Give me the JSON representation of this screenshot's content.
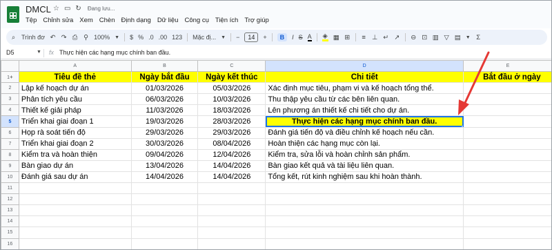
{
  "app": {
    "doc_title": "DMCL",
    "save_status": "Đang lưu...",
    "menu": [
      "Tệp",
      "Chỉnh sửa",
      "Xem",
      "Chèn",
      "Định dạng",
      "Dữ liệu",
      "Công cụ",
      "Tiện ích",
      "Trợ giúp"
    ]
  },
  "toolbar": {
    "search_label": "Trình đơ",
    "zoom": "100%",
    "currency": "$",
    "percent": "%",
    "dec_decrease": ".0",
    "dec_increase": ".00",
    "number_format": "123",
    "font_name": "Mặc đị...",
    "font_size": "14",
    "bold": "B",
    "italic": "I",
    "strike": "S",
    "text_color": "A",
    "minus": "−",
    "plus": "+"
  },
  "formula_bar": {
    "cell_ref": "D5",
    "fx": "fx",
    "content": "Thực hiện các hạng mục chính ban đầu."
  },
  "grid": {
    "columns": [
      "A",
      "B",
      "C",
      "D",
      "E"
    ],
    "selected_column": "D",
    "selected_row": 5,
    "row_numbers": [
      "1",
      "2",
      "3",
      "4",
      "5",
      "6",
      "7",
      "8",
      "9",
      "10",
      "11",
      "12",
      "13",
      "14",
      "15",
      "16"
    ],
    "header": [
      "Tiêu đề thẻ",
      "Ngày bắt đầu",
      "Ngày kết thúc",
      "Chi tiết",
      "Bắt đầu ở ngày"
    ],
    "rows": [
      [
        "Lập kế hoạch dự án",
        "01/03/2026",
        "05/03/2026",
        "Xác định mục tiêu, phạm vi và kế hoạch tổng thể."
      ],
      [
        "Phân tích yêu cầu",
        "06/03/2026",
        "10/03/2026",
        "Thu thập yêu cầu từ các bên liên quan."
      ],
      [
        "Thiết kế giải pháp",
        "11/03/2026",
        "18/03/2026",
        "Lên phương án thiết kế chi tiết cho dự án."
      ],
      [
        "Triển khai giai đoạn 1",
        "19/03/2026",
        "28/03/2026",
        "Thực hiện các hạng mục chính ban đầu."
      ],
      [
        "Họp rà soát tiến độ",
        "29/03/2026",
        "29/03/2026",
        "Đánh giá tiến độ và điều chỉnh kế hoạch nếu cần."
      ],
      [
        "Triển khai giai đoạn 2",
        "30/03/2026",
        "08/04/2026",
        "Hoàn thiện các hạng mục còn lại."
      ],
      [
        "Kiểm tra và hoàn thiện",
        "09/04/2026",
        "12/04/2026",
        "Kiểm tra, sửa lỗi và hoàn chỉnh sản phẩm."
      ],
      [
        "Bàn giao dự án",
        "13/04/2026",
        "14/04/2026",
        "Bàn giao kết quả và tài liệu liên quan."
      ],
      [
        "Đánh giá sau dự án",
        "14/04/2026",
        "14/04/2026",
        "Tổng kết, rút kinh nghiệm sau khi hoàn thành."
      ]
    ]
  },
  "colors": {
    "header_fill": "#ffff00",
    "selection": "#1a73e8",
    "annotation_arrow": "#e53935",
    "app_logo": "#188038"
  }
}
